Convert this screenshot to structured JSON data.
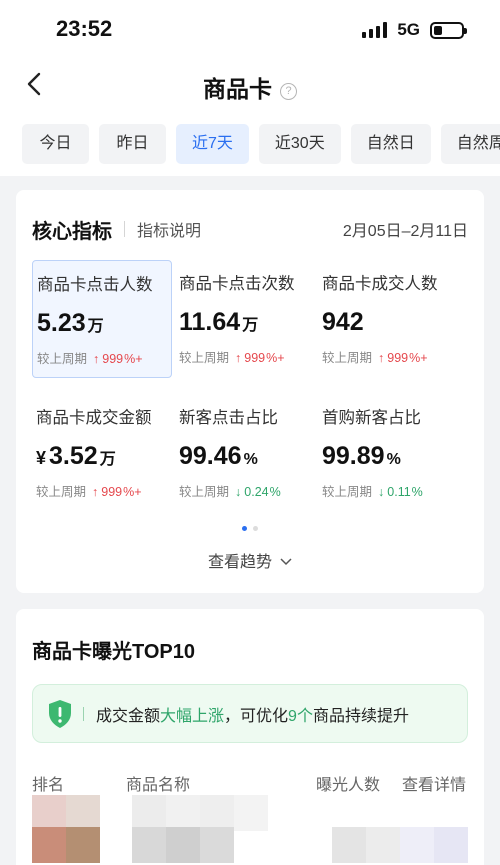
{
  "status_bar": {
    "time": "23:52",
    "network": "5G"
  },
  "nav": {
    "title": "商品卡",
    "back_icon": "chevron-left-icon",
    "help_icon": "question-circle-icon"
  },
  "tabs": [
    {
      "label": "今日",
      "active": false
    },
    {
      "label": "昨日",
      "active": false
    },
    {
      "label": "近7天",
      "active": true
    },
    {
      "label": "近30天",
      "active": false
    },
    {
      "label": "自然日",
      "active": false
    },
    {
      "label": "自然周",
      "active": false
    },
    {
      "label": "",
      "active": false
    }
  ],
  "core": {
    "title": "核心指标",
    "explain_link": "指标说明",
    "date_range": "2月05日–2月11日",
    "compare_label": "较上周期",
    "metrics": [
      {
        "label": "商品卡点击人数",
        "prefix": "",
        "value": "5.23",
        "unit": "万",
        "change": "999",
        "change_unit": "%+",
        "direction": "up",
        "selected": true
      },
      {
        "label": "商品卡点击次数",
        "prefix": "",
        "value": "11.64",
        "unit": "万",
        "change": "999",
        "change_unit": "%+",
        "direction": "up",
        "selected": false
      },
      {
        "label": "商品卡成交人数",
        "prefix": "",
        "value": "942",
        "unit": "",
        "change": "999",
        "change_unit": "%+",
        "direction": "up",
        "selected": false
      },
      {
        "label": "商品卡成交金额",
        "prefix": "¥",
        "value": "3.52",
        "unit": "万",
        "change": "999",
        "change_unit": "%+",
        "direction": "up",
        "selected": false
      },
      {
        "label": "新客点击占比",
        "prefix": "",
        "value": "99.46",
        "unit": "%",
        "change": "0.24",
        "change_unit": "%",
        "direction": "down",
        "selected": false
      },
      {
        "label": "首购新客占比",
        "prefix": "",
        "value": "99.89",
        "unit": "%",
        "change": "0.11",
        "change_unit": "%",
        "direction": "down",
        "selected": false
      }
    ],
    "pager": {
      "pages": 2,
      "current": 1
    },
    "trend_link": "查看趋势"
  },
  "top10": {
    "title": "商品卡曝光TOP10",
    "tip": {
      "part1": "成交金额",
      "highlight1": "大幅上涨",
      "part2": "，可优化",
      "highlight2": "9个",
      "part3": "商品持续提升"
    },
    "columns": [
      "排名",
      "商品名称",
      "曝光人数",
      "查看详情"
    ]
  },
  "colors": {
    "accent": "#2b6ff0",
    "up": "#e5484d",
    "down": "#2fa56a",
    "tip_bg": "#eefaf1"
  }
}
